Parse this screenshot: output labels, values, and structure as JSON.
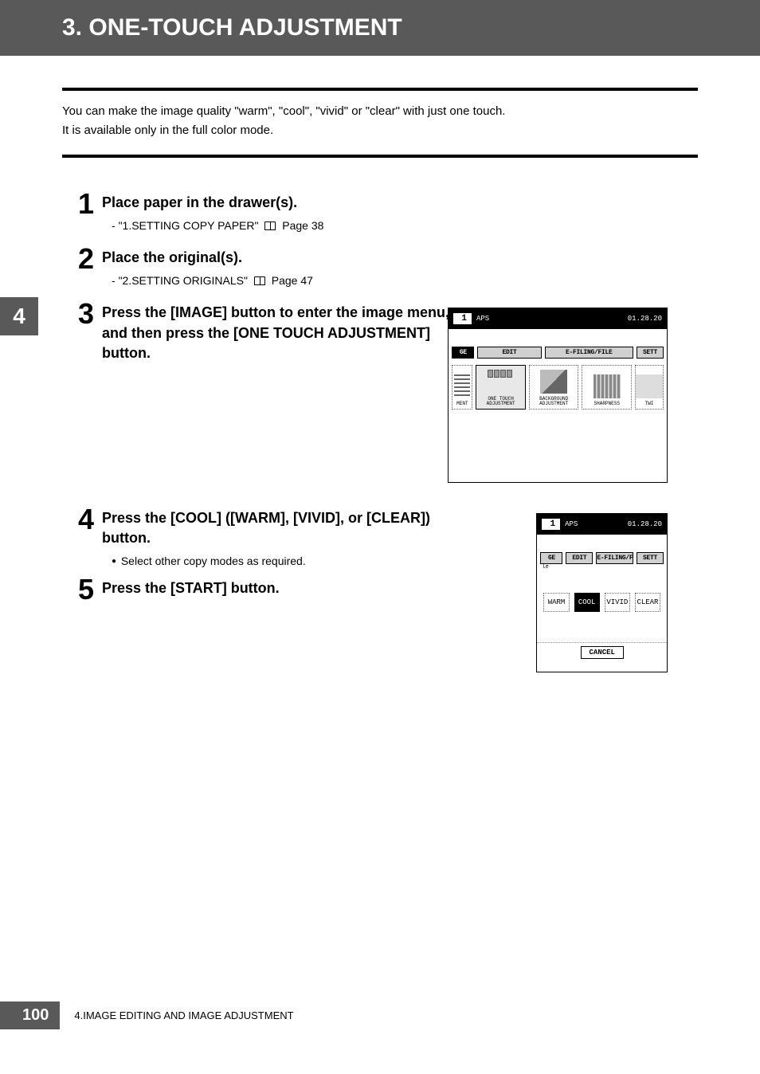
{
  "header": {
    "title": "3. ONE-TOUCH ADJUSTMENT"
  },
  "intro": {
    "line1": "You can make the image quality \"warm\", \"cool\", \"vivid\" or \"clear\" with just one touch.",
    "line2": "It is available only in the full color mode."
  },
  "side_tab": "4",
  "steps": [
    {
      "num": "1",
      "title": "Place paper in the drawer(s).",
      "ref": {
        "text": "\"1.SETTING COPY PAPER\"",
        "page": "Page 38"
      }
    },
    {
      "num": "2",
      "title": "Place the original(s).",
      "ref": {
        "text": "\"2.SETTING ORIGINALS\"",
        "page": "Page 47"
      }
    },
    {
      "num": "3",
      "title": "Press the [IMAGE] button to enter the image menu, and then press the [ONE TOUCH ADJUSTMENT] button."
    },
    {
      "num": "4",
      "title": "Press the [COOL] ([WARM], [VIVID], or [CLEAR]) button.",
      "bullet": "Select other copy modes as required."
    },
    {
      "num": "5",
      "title": "Press the [START] button."
    }
  ],
  "screenshot1": {
    "counter": "1",
    "aps": "APS",
    "time": "01.28.20",
    "tabs": {
      "ge": "GE",
      "edit": "EDIT",
      "efiling": "E-FILING/FILE",
      "sett": "SETT"
    },
    "icons": {
      "ment_cut": "MENT",
      "onetouch": "ONE TOUCH ADJUSTMENT",
      "background": "BACKGROUND ADJUSTMENT",
      "sharpness": "SHARPNESS",
      "twi_cut": "TWI"
    }
  },
  "screenshot2": {
    "counter": "1",
    "aps": "APS",
    "time": "01.28.20",
    "tabs": {
      "ge": "GE",
      "edit": "EDIT",
      "efiling": "E-FILING/FILE",
      "sett": "SETT"
    },
    "sub": "le",
    "modes": {
      "warm": "WARM",
      "cool": "COOL",
      "vivid": "VIVID",
      "clear": "CLEAR"
    },
    "cancel": "CANCEL"
  },
  "footer": {
    "page": "100",
    "chapter": "4.IMAGE EDITING AND IMAGE ADJUSTMENT"
  }
}
